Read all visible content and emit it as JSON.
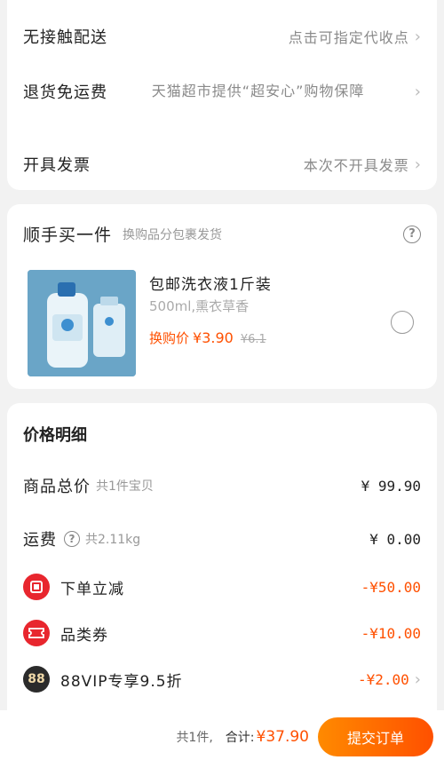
{
  "delivery": {
    "contactless_label": "无接触配送",
    "contactless_value": "点击可指定代收点",
    "return_label": "退货免运费",
    "return_value": "天猫超市提供“超安心”购物保障",
    "invoice_label": "开具发票",
    "invoice_value": "本次不开具发票"
  },
  "addon": {
    "title": "顺手买一件",
    "subtitle": "换购品分包裹发货",
    "product_name": "包邮洗衣液1斤装",
    "product_spec": "500ml,熏衣草香",
    "price_prefix": "换购价",
    "price": "¥3.90",
    "original_price": "¥6.1"
  },
  "price_detail": {
    "title": "价格明细",
    "goods_label": "商品总价",
    "goods_sub": "共1件宝贝",
    "goods_amount": "¥ 99.90",
    "shipping_label": "运费",
    "shipping_sub": "共2.11kg",
    "shipping_amount": "¥ 0.00",
    "discount_label": "下单立减",
    "discount_amount": "-¥50.00",
    "coupon_label": "品类券",
    "coupon_amount": "-¥10.00",
    "vip_badge": "88",
    "vip_label": "88VIP专享9.5折",
    "vip_amount": "-¥2.00"
  },
  "bottom": {
    "count": "共1件,",
    "total_label": "合计:",
    "total": "¥37.90",
    "submit": "提交订单"
  },
  "colors": {
    "accent": "#ff5000",
    "coupon_red": "#e8262e"
  }
}
